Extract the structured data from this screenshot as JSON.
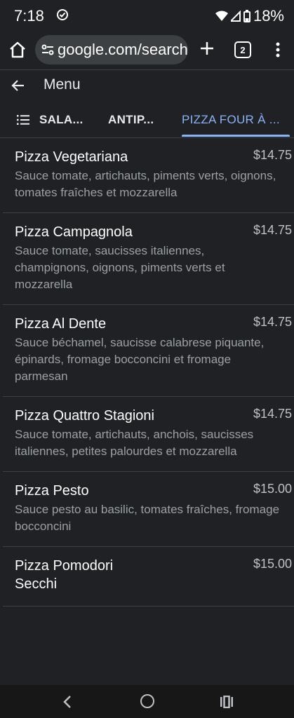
{
  "status": {
    "time": "7:18",
    "battery": "18%"
  },
  "browser": {
    "url": "google.com/search",
    "tab_count": "2"
  },
  "header": {
    "title": "Menu"
  },
  "category_tabs": [
    {
      "label": "SALA..."
    },
    {
      "label": "ANTIP..."
    },
    {
      "label": "PIZZA FOUR À ..."
    }
  ],
  "menu_items": [
    {
      "name": "Pizza Vegetariana",
      "price": "$14.75",
      "description": "Sauce tomate, artichauts, piments verts, oignons, tomates fraîches et mozzarella"
    },
    {
      "name": "Pizza Campagnola",
      "price": "$14.75",
      "description": "Sauce tomate, saucisses italiennes, champignons, oignons, piments verts et mozzarella"
    },
    {
      "name": "Pizza Al Dente",
      "price": "$14.75",
      "description": "Sauce béchamel, saucisse calabrese piquante, épinards, fromage bocconcini et fromage parmesan"
    },
    {
      "name": "Pizza Quattro Stagioni",
      "price": "$14.75",
      "description": "Sauce tomate, artichauts, anchois, saucisses italiennes, petites palourdes et mozzarella"
    },
    {
      "name": "Pizza Pesto",
      "price": "$15.00",
      "description": "Sauce pesto au basilic, tomates fraîches, fromage bocconcini"
    },
    {
      "name": "Pizza Pomodori Secchi",
      "price": "$15.00",
      "description": ""
    }
  ],
  "colors": {
    "background": "#202124",
    "accent": "#8ab4f8",
    "divider": "#3c4043"
  }
}
